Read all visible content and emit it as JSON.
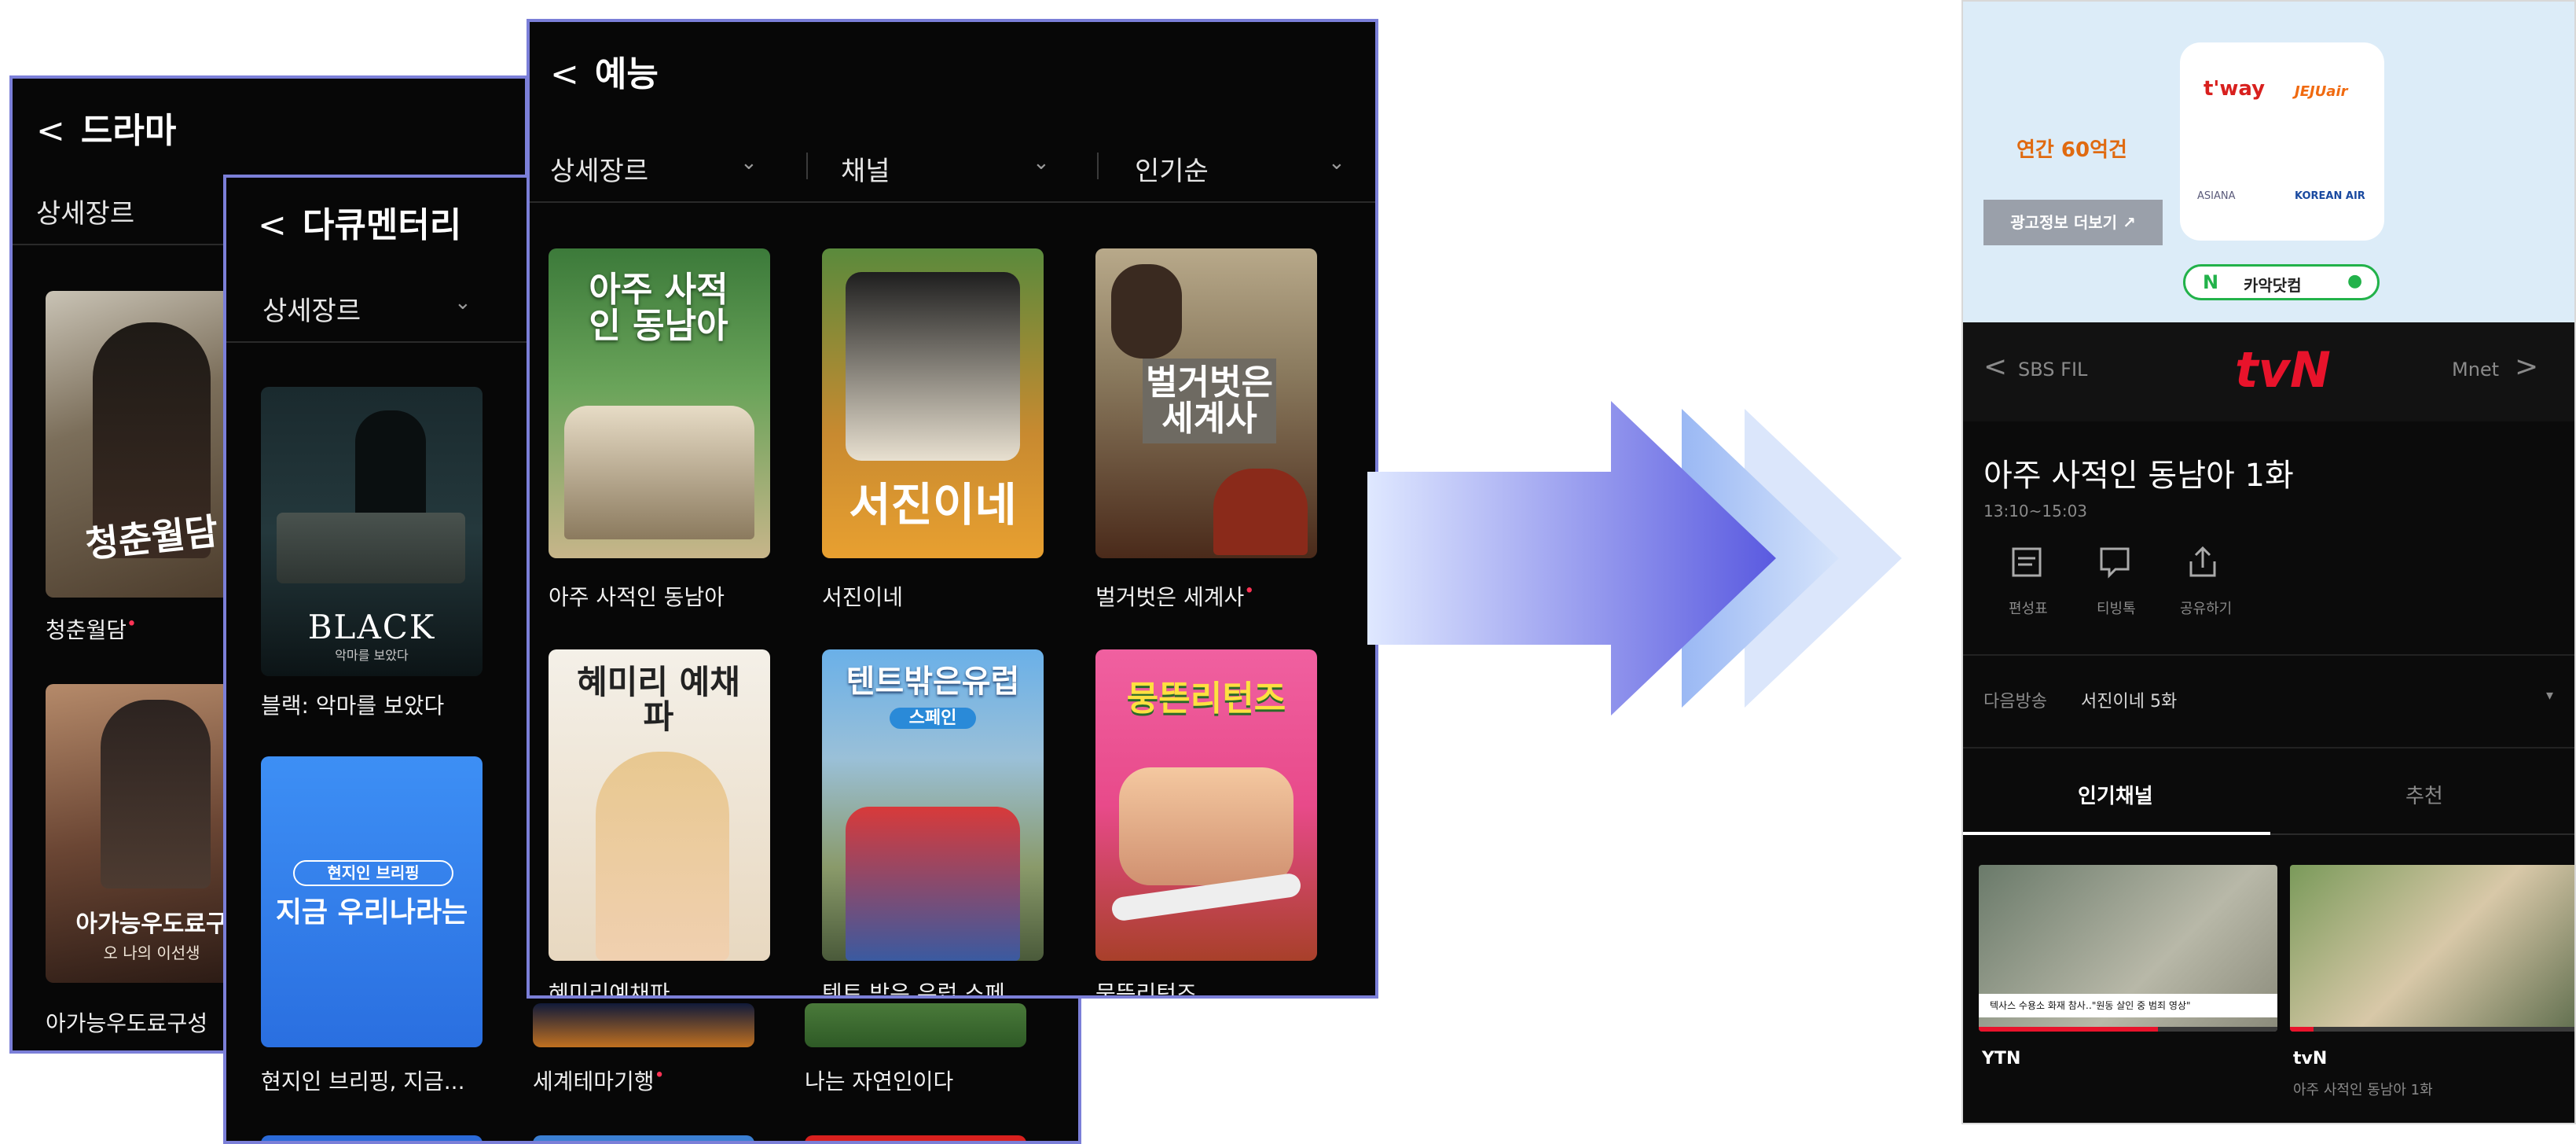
{
  "drama": {
    "title": "드라마",
    "filter": "상세장르",
    "items": [
      {
        "title": "청춘월담",
        "art": "청춘월담"
      },
      {
        "title": "아가능우도료구성",
        "art": "아가능우도료구",
        "sub": "오 나의 이선생"
      }
    ]
  },
  "docu": {
    "title": "다큐멘터리",
    "filter": "상세장르",
    "items": [
      {
        "title": "블랙: 악마를 보았다",
        "art": "BLACK",
        "sub": "악마를 보았다"
      },
      {
        "title": "현지인 브리핑, 지금...",
        "art": "지금 우리나라는",
        "badge": "현지인 브리핑"
      },
      {
        "title": "세계테마기행"
      },
      {
        "title": "나는 자연인이다"
      }
    ]
  },
  "variety": {
    "title": "예능",
    "filters": [
      "상세장르",
      "채널",
      "인기순"
    ],
    "items": [
      {
        "title": "아주 사적인 동남아",
        "art": "아주 사적인 동남아"
      },
      {
        "title": "서진이네",
        "art": "서진이네"
      },
      {
        "title": "벌거벗은 세계사",
        "art": "벌거벗은 세계사"
      },
      {
        "title": "혜미리예채파",
        "art": "혜미리 예채파"
      },
      {
        "title": "텐트 밖은 유럽 스페",
        "art": "텐트밖은유럽",
        "sub": "스페인"
      },
      {
        "title": "뭉뜬리턴즈",
        "art": "뭉뜬리턴즈"
      }
    ]
  },
  "phone": {
    "ad": {
      "text": "연간 60억건",
      "button": "광고정보 더보기 ↗",
      "logos": [
        "t'way",
        "JEJUair",
        "ASIANA",
        "KOREAN AIR"
      ],
      "search_label": "카악닷컴",
      "naver": "N"
    },
    "channel_prev": "SBS FIL",
    "channel_current": "tvN",
    "channel_next": "Mnet",
    "program_title": "아주 사적인 동남아 1화",
    "program_time": "13:10~15:03",
    "actions": [
      "편성표",
      "티빙톡",
      "공유하기"
    ],
    "next_label": "다음방송",
    "next_value": "서진이네 5화",
    "tabs": [
      "인기채널",
      "추천"
    ],
    "channels": [
      {
        "name": "YTN",
        "ticker": "텍사스 수용소 화재 참사‥\"원동 살인 중 범죄 영상\""
      },
      {
        "name": "tvN",
        "program": "아주 사적인 동남아 1화"
      }
    ]
  },
  "colors": {
    "accent_border": "#7b7fd8",
    "tvn_red": "#e8132b",
    "arrow": "#6f6fe6"
  }
}
